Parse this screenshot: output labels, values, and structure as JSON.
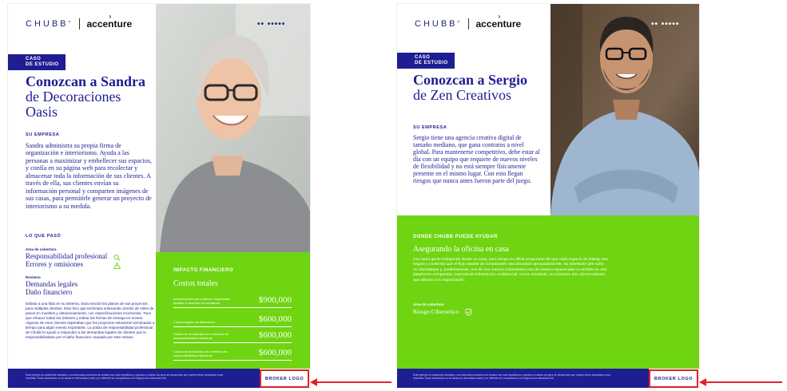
{
  "brand": {
    "chubb": "CHUBB",
    "chubb_reg": "®",
    "accenture": "accenture",
    "dots_p1": "•• •••••",
    "dots_p2": "•• •••••"
  },
  "colors": {
    "navy": "#1e1d92",
    "green": "#6fd412",
    "red_highlight": "#e0232b"
  },
  "page1": {
    "badge_line1": "CASO",
    "badge_line2": "DE ESTUDIO",
    "title_bold": "Conozcan a Sandra",
    "title_rest_1": "de Decoraciones",
    "title_rest_2": "Oasis",
    "company_label": "SU EMPRESA",
    "company_text": "Sandra administra su propia firma de organización e interiorismo. Ayuda a las personas a maximizar y embellecer sus espacios, y confía en su página web para recolectar y almacenar toda la información de sus clientes. A través de ella, sus clientes envían su información personal y comparten imágenes de sus casas, para permitirle generar un proyecto de interiorismo a su medida.",
    "what_label": "LO QUE PASÓ",
    "coverage_label": "Área de cobertura",
    "coverage_1": "Responsabilidad profesional",
    "coverage_2": "Errores y omisiones",
    "claim_label": "Reclamo",
    "claim_1": "Demandas legales",
    "claim_2": "Daño financiero",
    "story": "Debido a una falla en su sistema, Sara mezcló los planos de sus proyectos para múltiples clientes. Esto hizo que terminara ordenando cientos de miles de pesos en muebles y almacenamiento, con especificaciones incorrectas. Tuvo que rehacer todas las órdenes y estirar las fechas de entrega en meses. Algunos de esos clientes esperaban que los proyectos estuvieran terminados a tiempo para algún evento importante. La póliza de responsabilidad profesional de Chubb le ayudó a responder a las demandas legales de clientes que le responsabilizaban por el daño financiero causado por este retraso.",
    "impact_label": "IMPACTO FINANCIERO",
    "costs_label": "Costos totales",
    "costs": [
      {
        "label": "Indemnización para clientes impactados durante el acuerdo de mediación",
        "value": "$900,000"
      },
      {
        "label": "Costos legales de defensoría",
        "value": "$600,000"
      },
      {
        "label": "Costos de demandas con cobertura de responsabilidad profesional",
        "value": "$600,000"
      },
      {
        "label": "Costos de demandas sin cobertura de responsabilidad profesional",
        "value": "$600,000"
      }
    ],
    "footer": "Este ejemplo es solamente ilustrativo, sus escenarios descritos de reclamo son solo hipotéticos y ayudan a mostrar los tipos de situaciones que pueden tener demandas como resultado. Estos escenarios no se basan en demandas reales y no deberán ser comparados con ninguna otra demanda real.",
    "broker_logo": "BROKER LOGO"
  },
  "page2": {
    "badge_line1": "CASO",
    "badge_line2": "DE ESTUDIO",
    "title_bold": "Conozcan a Sergio",
    "title_rest_1": "de Zen Creativos",
    "company_label": "SU EMPRESA",
    "company_text": "Sergio tiene una agencia creativa digital de tamaño mediano, que gana contratos a nivel global. Para mantenerse competitivo, debe estar al día con un equipo que requiere de nuevos niveles de flexibilidad y no está siempre físicamente presente en el mismo lugar. Con esto llegan riesgos que nunca antes fueron parte del juego.",
    "help_label": "DONDE CHUBB PUEDE AYUDAR",
    "help_sub": "Asegurando la oficina en casa",
    "help_text": "Con tanta gente trabajando desde su casa, para Sergio es difícil asegurarse de que cada espacio de trabajo sea seguro y confirmar que el flujo estable de contratantes sea abordado apropiadamente. Su diseñador jefe sufre un ciberataque y, paralelamente, uno de sus nuevos contratantes usa de manera equivocada un archivo en una plataforma compartida, exponiendo información confidencial. Como resultado, se producen dos ciberincidentes que afectan a la organización.",
    "coverage_label": "Área de cobertura",
    "coverage_1": "Riesgo Cibernético",
    "footer": "Este ejemplo es solamente ilustrativo, sus escenarios descritos de reclamo son solo hipotéticos y ayudan a mostrar los tipos de situaciones que pueden tener demandas como resultado. Estos escenarios no se basan en demandas reales y no deberán ser comparados con ninguna otra demanda real.",
    "broker_logo": "BROKER LOGO"
  }
}
